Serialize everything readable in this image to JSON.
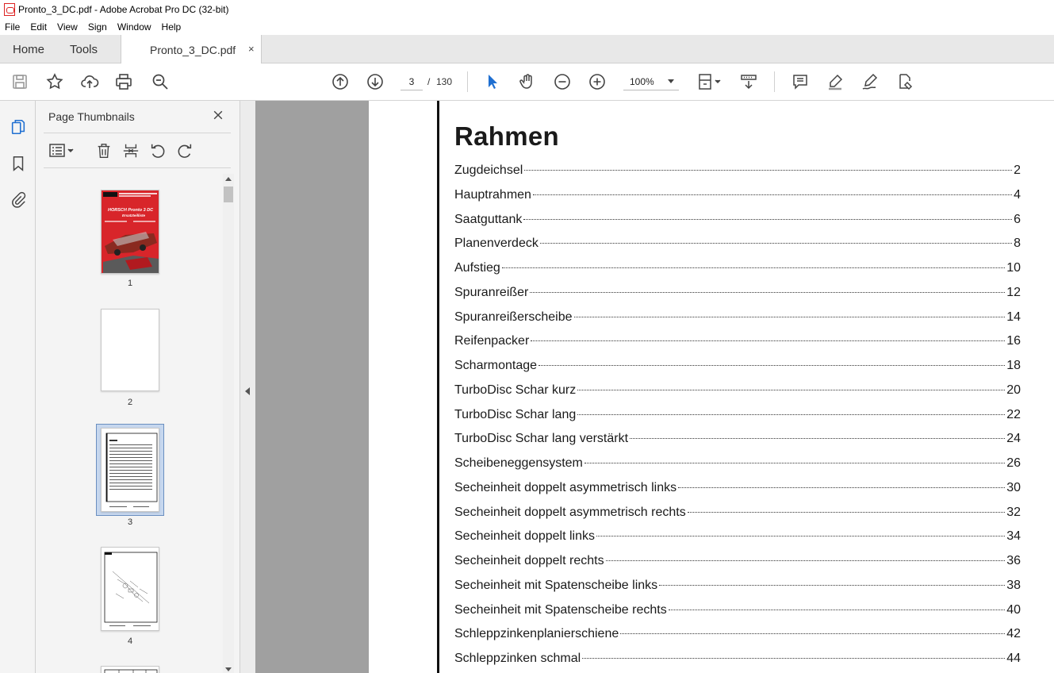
{
  "window": {
    "title": "Pronto_3_DC.pdf - Adobe Acrobat Pro DC (32-bit)"
  },
  "menu": [
    "File",
    "Edit",
    "View",
    "Sign",
    "Window",
    "Help"
  ],
  "tabs": {
    "home": "Home",
    "tools": "Tools",
    "document": "Pronto_3_DC.pdf",
    "close_glyph": "×"
  },
  "toolbar": {
    "icons": [
      "save-icon",
      "star-icon",
      "upload-icon",
      "print-icon",
      "zoom-search-icon",
      "page-up-icon",
      "page-down-icon",
      "select-arrow-icon",
      "hand-icon",
      "zoom-out-icon",
      "zoom-in-icon",
      "fit-page-icon",
      "scroll-mode-icon",
      "comment-icon",
      "highlight-icon",
      "sign-icon",
      "stamp-icon"
    ],
    "current_page": "3",
    "page_separator": "/",
    "total_pages": "130",
    "zoom": "100%"
  },
  "sidebar": {
    "title": "Page Thumbnails",
    "close_glyph": "×",
    "rail_icons": [
      "pages-icon",
      "bookmark-icon",
      "attachment-icon"
    ],
    "thumb_tool_icons": [
      "options-icon",
      "delete-icon",
      "extract-icon",
      "rotate-left-icon",
      "rotate-right-icon"
    ],
    "thumbnails": [
      {
        "label": "1",
        "selected": false,
        "cover_text": "HORSCH Pronto 3 DC",
        "cover_subtext": "Ersatzteilliste"
      },
      {
        "label": "2",
        "selected": false
      },
      {
        "label": "3",
        "selected": true
      },
      {
        "label": "4",
        "selected": false
      }
    ]
  },
  "document": {
    "heading": "Rahmen",
    "toc": [
      {
        "title": "Zugdeichsel",
        "page": "2"
      },
      {
        "title": "Hauptrahmen",
        "page": "4"
      },
      {
        "title": "Saatguttank",
        "page": "6"
      },
      {
        "title": "Planenverdeck",
        "page": "8"
      },
      {
        "title": "Aufstieg",
        "page": "10"
      },
      {
        "title": "Spuranreißer",
        "page": "12"
      },
      {
        "title": "Spuranreißerscheibe",
        "page": "14"
      },
      {
        "title": "Reifenpacker",
        "page": "16"
      },
      {
        "title": "Scharmontage",
        "page": "18"
      },
      {
        "title": "TurboDisc Schar kurz",
        "page": "20"
      },
      {
        "title": "TurboDisc Schar lang",
        "page": "22"
      },
      {
        "title": "TurboDisc Schar lang verstärkt",
        "page": "24"
      },
      {
        "title": "Scheibeneggensystem",
        "page": "26"
      },
      {
        "title": "Secheinheit doppelt asymmetrisch links",
        "page": "30"
      },
      {
        "title": "Secheinheit doppelt asymmetrisch rechts",
        "page": "32"
      },
      {
        "title": "Secheinheit doppelt links",
        "page": "34"
      },
      {
        "title": "Secheinheit doppelt rechts",
        "page": "36"
      },
      {
        "title": "Secheinheit mit Spatenscheibe links",
        "page": "38"
      },
      {
        "title": "Secheinheit mit Spatenscheibe rechts",
        "page": "40"
      },
      {
        "title": "Schleppzinkenplanierschiene",
        "page": "42"
      },
      {
        "title": "Schleppzinken schmal",
        "page": "44"
      }
    ]
  },
  "colors": {
    "accent_blue": "#1f6fd1",
    "cover_red": "#d8252a",
    "doc_background": "#a0a0a0"
  }
}
